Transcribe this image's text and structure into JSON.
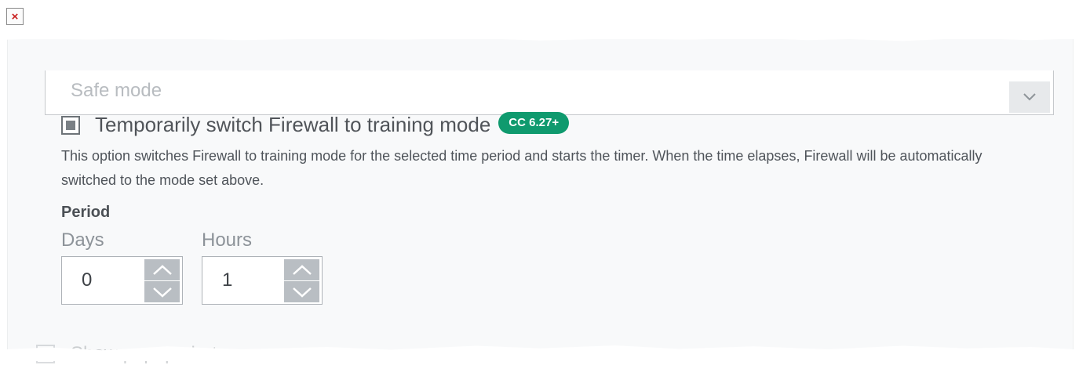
{
  "window": {
    "close_glyph": "×",
    "close_icon": "close-icon"
  },
  "mode_select": {
    "value": "Safe mode",
    "arrow_icon": "chevron-down-icon"
  },
  "training_mode": {
    "checked": true,
    "label": "Temporarily switch Firewall to training mode",
    "badge": "CC 6.27+",
    "badge_color": "#0f9a6e",
    "description": "This option switches Firewall to training mode for the selected time period and starts the timer. When the time elapses, Firewall will be automatically switched to the mode set above."
  },
  "period": {
    "title": "Period",
    "days": {
      "label": "Days",
      "value": "0"
    },
    "hours": {
      "label": "Hours",
      "value": "1"
    }
  },
  "next_option": {
    "label": "Show popup alerts"
  }
}
